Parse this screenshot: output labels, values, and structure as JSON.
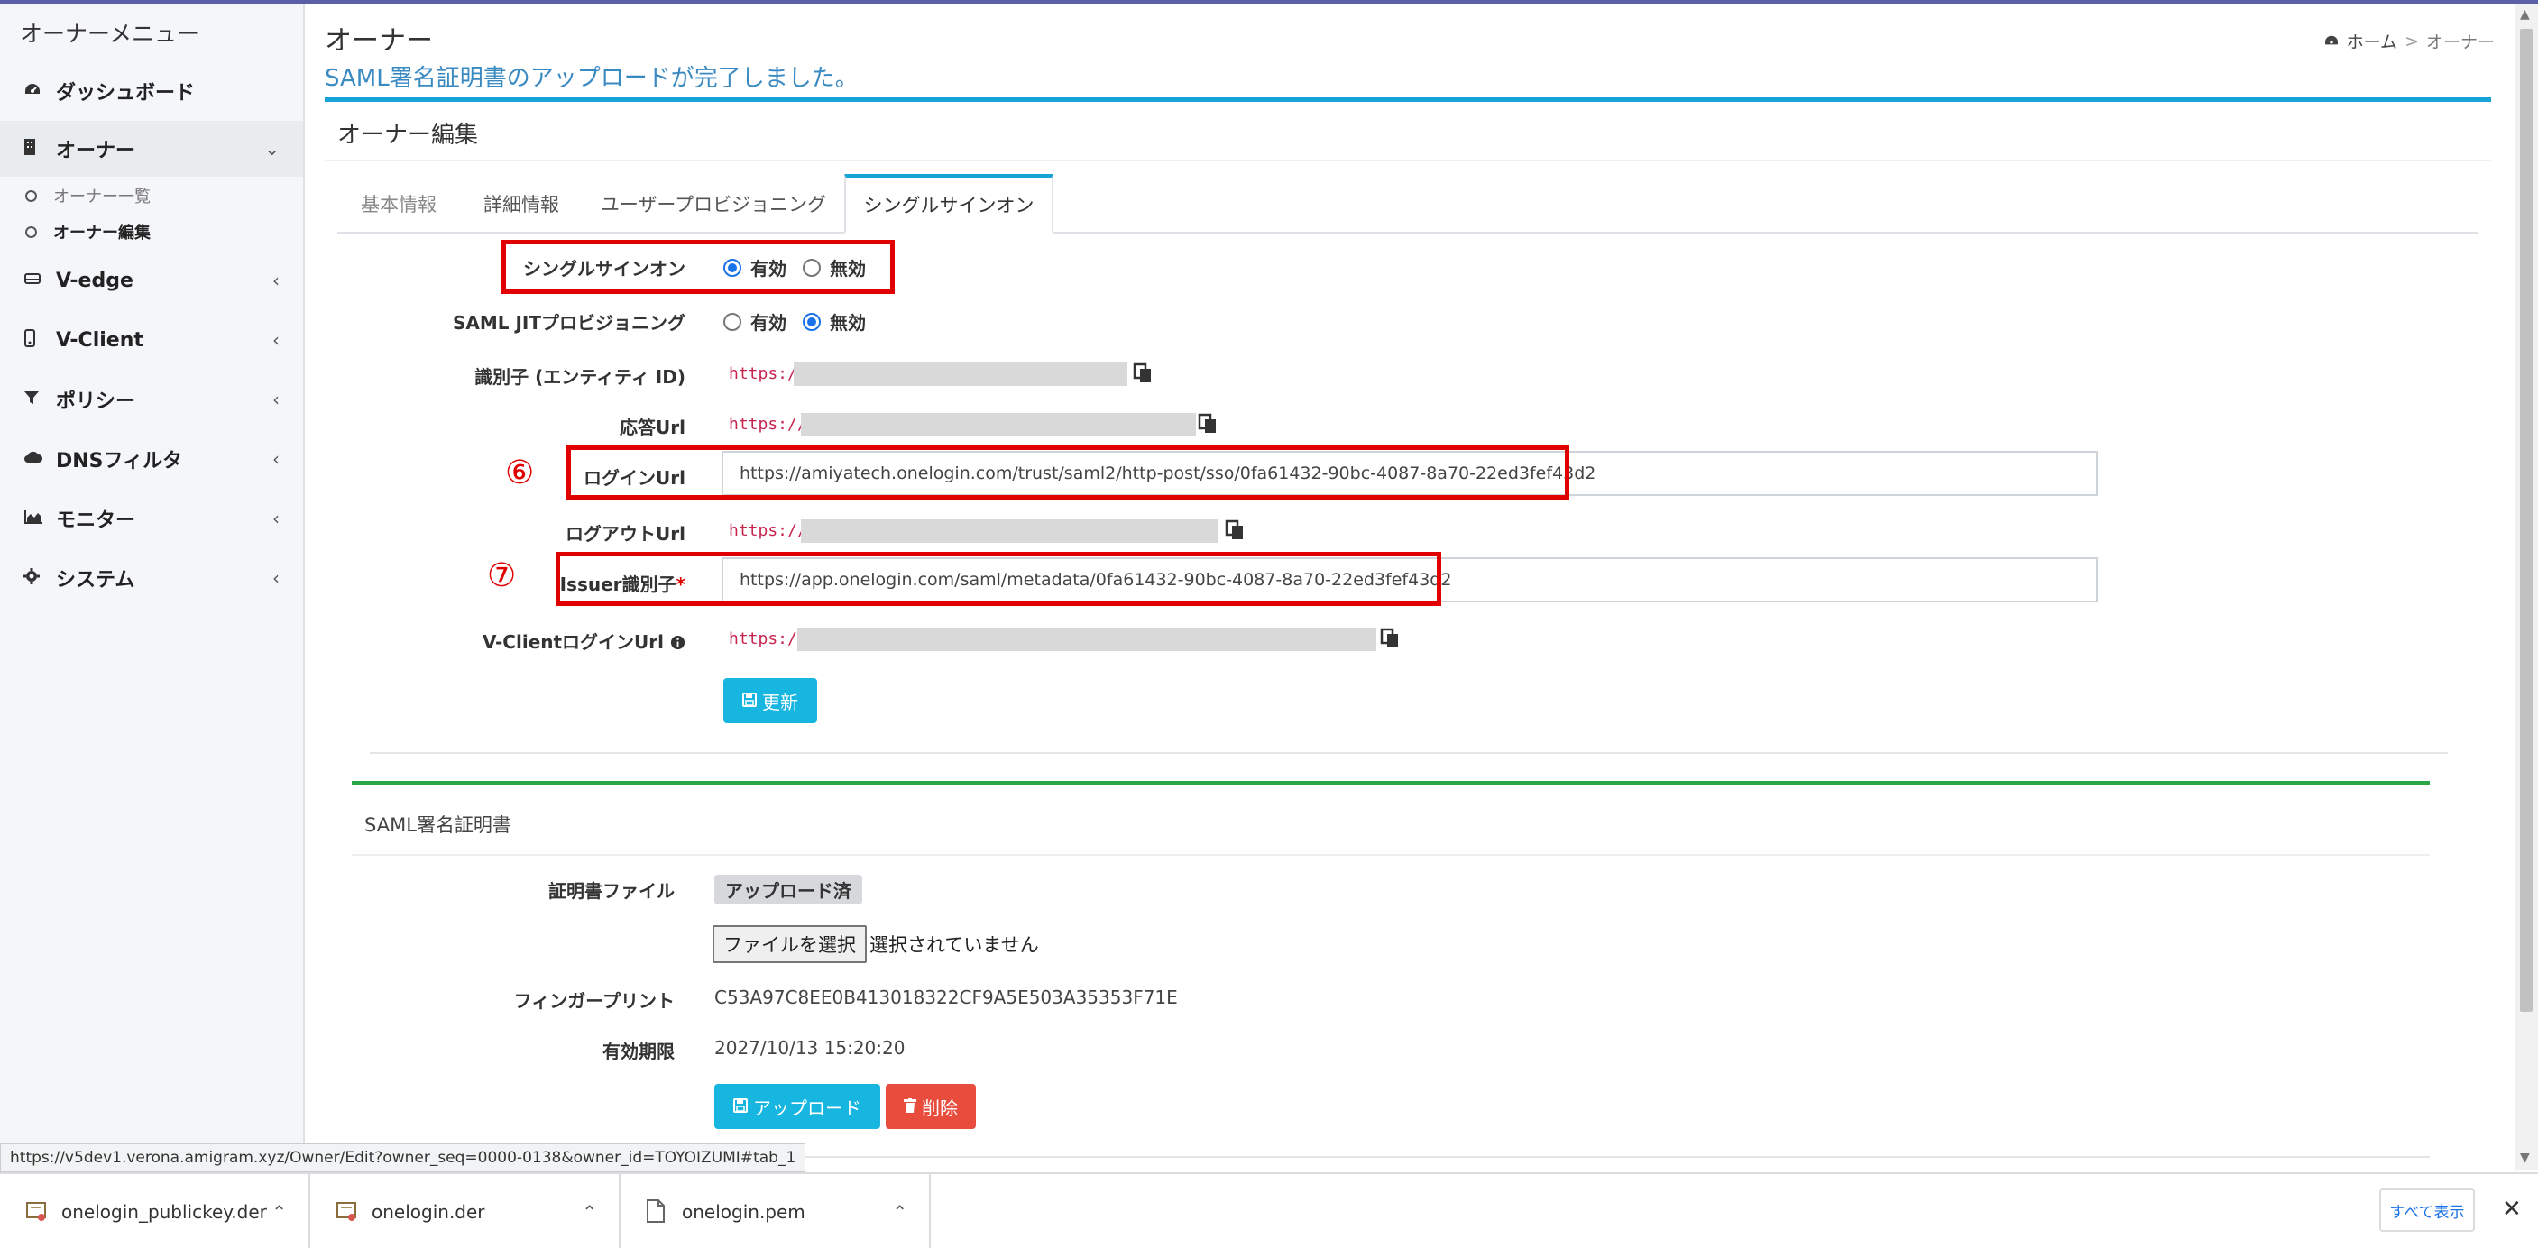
{
  "sidebar": {
    "title": "オーナーメニュー",
    "items": [
      {
        "label": "ダッシュボード",
        "icon": "dashboard-icon",
        "chevron": ""
      },
      {
        "label": "オーナー",
        "icon": "building-icon",
        "chevron": "⌄"
      },
      {
        "label": "V-edge",
        "icon": "hdd-icon",
        "chevron": "‹"
      },
      {
        "label": "V-Client",
        "icon": "mobile-icon",
        "chevron": "‹"
      },
      {
        "label": "ポリシー",
        "icon": "filter-icon",
        "chevron": "‹"
      },
      {
        "label": "DNSフィルタ",
        "icon": "cloud-icon",
        "chevron": "‹"
      },
      {
        "label": "モニター",
        "icon": "chart-area-icon",
        "chevron": "‹"
      },
      {
        "label": "システム",
        "icon": "gear-icon",
        "chevron": "‹"
      }
    ],
    "sub_items": [
      {
        "label": "オーナー一覧"
      },
      {
        "label": "オーナー編集"
      }
    ]
  },
  "header": {
    "title": "オーナー",
    "message": "SAML署名証明書のアップロードが完了しました。",
    "breadcrumb": {
      "home": "ホーム",
      "separator": ">",
      "current": "オーナー"
    }
  },
  "card": {
    "title": "オーナー編集",
    "tabs": [
      "基本情報",
      "詳細情報",
      "ユーザープロビジョニング",
      "シングルサインオン"
    ]
  },
  "form": {
    "sso_label": "シングルサインオン",
    "sso_on": "有効",
    "sso_off": "無効",
    "jit_label": "SAML JITプロビジョニング",
    "jit_on": "有効",
    "jit_off": "無効",
    "entity_id_label": "識別子 (エンティティ ID)",
    "entity_id_value": "https:/",
    "reply_url_label": "応答Url",
    "reply_url_value": "https://",
    "login_url_label": "ログインUrl",
    "login_url_value": "https://amiyatech.onelogin.com/trust/saml2/http-post/sso/0fa61432-90bc-4087-8a70-22ed3fef43d2",
    "logout_url_label": "ログアウトUrl",
    "logout_url_value": "https://",
    "issuer_label": "Issuer識別子",
    "issuer_required": "*",
    "issuer_value": "https://app.onelogin.com/saml/metadata/0fa61432-90bc-4087-8a70-22ed3fef43d2",
    "vclient_login_label": "V-ClientログインUrl",
    "vclient_login_value": "https:/.",
    "update_button": "更新",
    "annotation_6": "⑥",
    "annotation_7": "⑦"
  },
  "cert": {
    "title": "SAML署名証明書",
    "file_label": "証明書ファイル",
    "file_status": "アップロード済",
    "choose_file": "ファイルを選択",
    "no_file": "選択されていません",
    "fingerprint_label": "フィンガープリント",
    "fingerprint_value": "C53A97C8EE0B413018322CF9A5E503A35353F71E",
    "expiry_label": "有効期限",
    "expiry_value": "2027/10/13 15:20:20",
    "upload_button": "アップロード",
    "delete_button": "削除"
  },
  "status_url": "https://v5dev1.verona.amigram.xyz/Owner/Edit?owner_seq=0000-0138&owner_id=TOYOIZUMI#tab_1",
  "downloads": {
    "files": [
      "onelogin_publickey.der",
      "onelogin.der",
      "onelogin.pem"
    ],
    "show_all": "すべて表示",
    "close": "✕"
  },
  "colors": {
    "accent": "#17a2d8",
    "highlight": "#e00000",
    "success": "#28a745",
    "danger": "#e74c3c"
  }
}
